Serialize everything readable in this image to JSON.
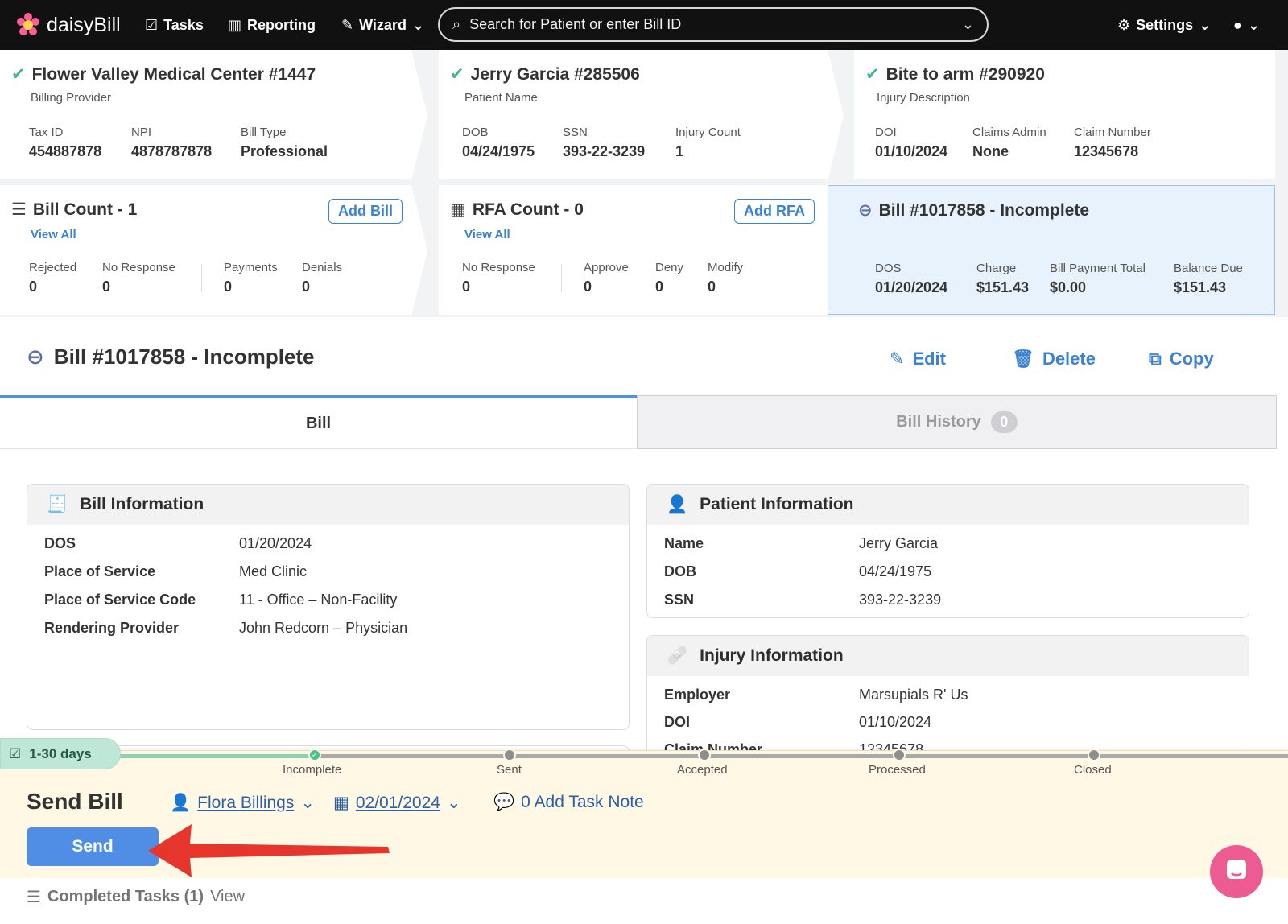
{
  "app": {
    "brand": "daisyBill"
  },
  "nav": {
    "tasks": "Tasks",
    "reporting": "Reporting",
    "wizard": "Wizard",
    "search_placeholder": "Search for Patient or enter Bill ID",
    "settings": "Settings"
  },
  "summary": {
    "provider": {
      "title": "Flower Valley Medical Center #1447",
      "subtitle": "Billing Provider",
      "fields": [
        {
          "label": "Tax ID",
          "value": "454887878"
        },
        {
          "label": "NPI",
          "value": "4878787878"
        },
        {
          "label": "Bill Type",
          "value": "Professional"
        }
      ]
    },
    "patient": {
      "title": "Jerry Garcia #285506",
      "subtitle": "Patient Name",
      "fields": [
        {
          "label": "DOB",
          "value": "04/24/1975"
        },
        {
          "label": "SSN",
          "value": "393-22-3239"
        },
        {
          "label": "Injury Count",
          "value": "1"
        }
      ]
    },
    "injury": {
      "title": "Bite to arm #290920",
      "subtitle": "Injury Description",
      "fields": [
        {
          "label": "DOI",
          "value": "01/10/2024"
        },
        {
          "label": "Claims Admin",
          "value": "None"
        },
        {
          "label": "Claim Number",
          "value": "12345678"
        }
      ]
    },
    "bills": {
      "title": "Bill Count - 1",
      "view_all": "View All",
      "button": "Add Bill",
      "fields": [
        {
          "label": "Rejected",
          "value": "0"
        },
        {
          "label": "No Response",
          "value": "0"
        },
        {
          "label": "Payments",
          "value": "0"
        },
        {
          "label": "Denials",
          "value": "0"
        }
      ]
    },
    "rfa": {
      "title": "RFA Count - 0",
      "view_all": "View All",
      "button": "Add RFA",
      "fields": [
        {
          "label": "No Response",
          "value": "0"
        },
        {
          "label": "Approve",
          "value": "0"
        },
        {
          "label": "Deny",
          "value": "0"
        },
        {
          "label": "Modify",
          "value": "0"
        }
      ]
    },
    "current_bill": {
      "title": "Bill #1017858 - Incomplete",
      "fields": [
        {
          "label": "DOS",
          "value": "01/20/2024"
        },
        {
          "label": "Charge",
          "value": "$151.43"
        },
        {
          "label": "Bill Payment Total",
          "value": "$0.00"
        },
        {
          "label": "Balance Due",
          "value": "$151.43"
        }
      ]
    }
  },
  "bill": {
    "title": "Bill #1017858 - Incomplete",
    "actions": {
      "edit": "Edit",
      "delete": "Delete",
      "copy": "Copy"
    },
    "tabs": [
      {
        "label": "Bill"
      },
      {
        "label": "Bill History",
        "count": "0"
      }
    ]
  },
  "bill_information": {
    "heading": "Bill Information",
    "rows": [
      {
        "label": "DOS",
        "value": "01/20/2024"
      },
      {
        "label": "Place of Service",
        "value": "Med Clinic"
      },
      {
        "label": "Place of Service Code",
        "value": "11 - Office – Non-Facility"
      },
      {
        "label": "Rendering Provider",
        "value": "John Redcorn – Physician"
      }
    ]
  },
  "patient_information": {
    "heading": "Patient Information",
    "rows": [
      {
        "label": "Name",
        "value": "Jerry Garcia"
      },
      {
        "label": "DOB",
        "value": "04/24/1975"
      },
      {
        "label": "SSN",
        "value": "393-22-3239"
      }
    ]
  },
  "injury_information": {
    "heading": "Injury Information",
    "rows": [
      {
        "label": "Employer",
        "value": "Marsupials R' Us"
      },
      {
        "label": "DOI",
        "value": "01/10/2024"
      },
      {
        "label": "Claim Number",
        "value": "12345678"
      }
    ]
  },
  "task": {
    "days": "1-30 days",
    "statuses": [
      "Incomplete",
      "Sent",
      "Accepted",
      "Processed",
      "Closed"
    ],
    "title": "Send Bill",
    "assignee": "Flora Billings",
    "due_date": "02/01/2024",
    "note": "0 Add Task Note",
    "send": "Send",
    "completed": "Completed Tasks (1)",
    "view": "View"
  },
  "colors": {
    "brand": "#111111",
    "accent": "#3b82d1",
    "highlight": "#e8f2fc",
    "footer": "#fff8e5",
    "annotation_arrow": "#e5352c"
  }
}
